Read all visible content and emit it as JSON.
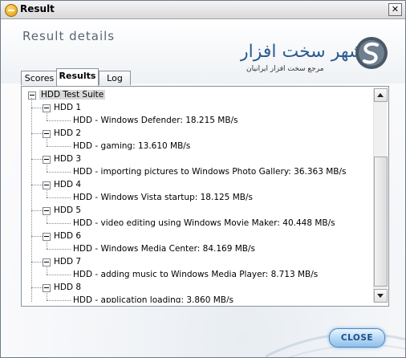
{
  "window": {
    "title": "Result",
    "close_glyph": "✕"
  },
  "header": {
    "heading": "Result details",
    "logo": {
      "name_text": "شهر سخت افزار",
      "tagline": "مرجع سخت افزار ایرانیان",
      "name_color": "#2b5c91",
      "tagline_color": "#333333"
    }
  },
  "tabs": [
    {
      "label": "Scores",
      "active": false
    },
    {
      "label": "Results",
      "active": true
    },
    {
      "label": "Log",
      "active": false
    }
  ],
  "tree": {
    "root": "HDD Test Suite",
    "groups": [
      {
        "label": "HDD 1",
        "child": "HDD - Windows Defender: 18.215 MB/s"
      },
      {
        "label": "HDD 2",
        "child": "HDD - gaming: 13.610 MB/s"
      },
      {
        "label": "HDD 3",
        "child": "HDD - importing pictures to Windows Photo Gallery: 36.363 MB/s"
      },
      {
        "label": "HDD 4",
        "child": "HDD - Windows Vista startup: 18.125 MB/s"
      },
      {
        "label": "HDD 5",
        "child": "HDD - video editing using Windows Movie Maker: 40.448 MB/s"
      },
      {
        "label": "HDD 6",
        "child": "HDD - Windows Media Center: 84.169 MB/s"
      },
      {
        "label": "HDD 7",
        "child": "HDD - adding music to Windows Media Player: 8.713 MB/s"
      },
      {
        "label": "HDD 8",
        "child": "HDD - application loading: 3.860 MB/s"
      }
    ]
  },
  "buttons": {
    "close_label": "CLOSE"
  },
  "colors": {
    "accent": "#4e86bd",
    "title_text": "#5a6573"
  }
}
